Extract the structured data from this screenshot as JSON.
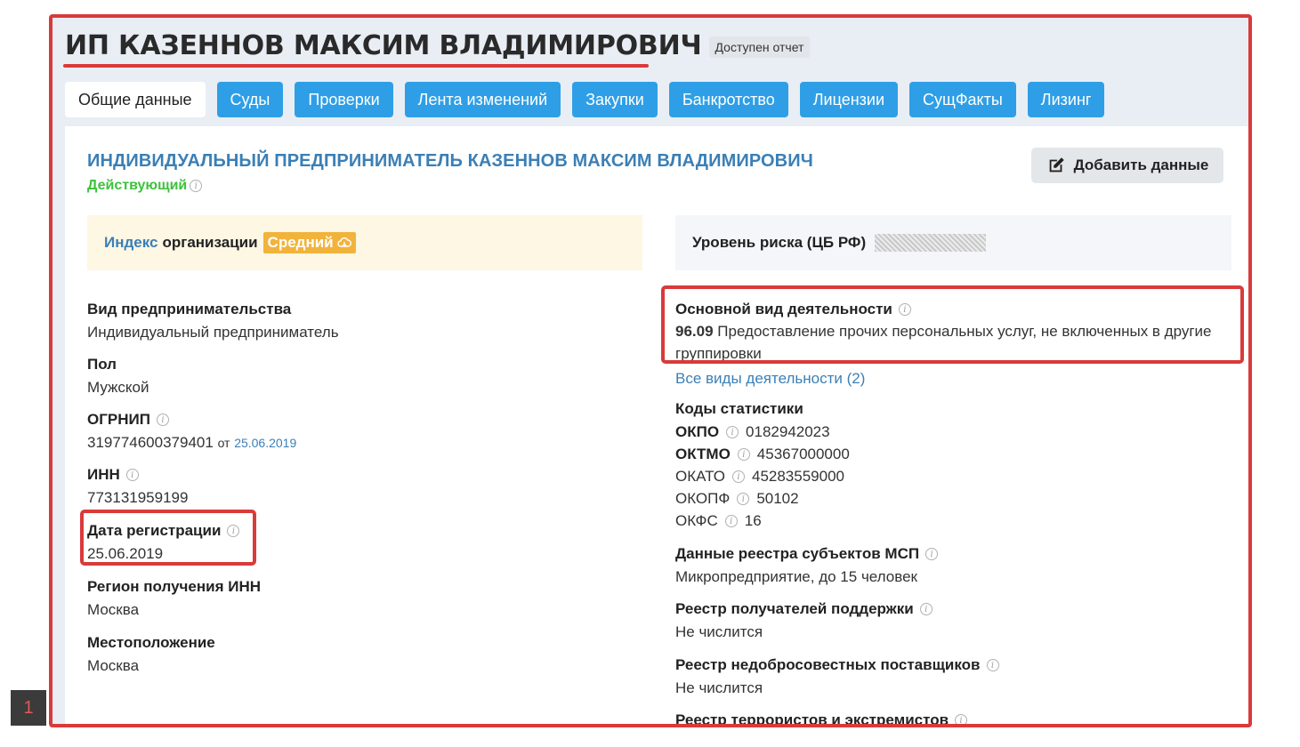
{
  "header": {
    "title": "ИП КАЗЕННОВ МАКСИМ ВЛАДИМИРОВИЧ",
    "badge": "Доступен отчет"
  },
  "tabs": [
    {
      "label": "Общие данные",
      "active": true
    },
    {
      "label": "Суды"
    },
    {
      "label": "Проверки"
    },
    {
      "label": "Лента изменений"
    },
    {
      "label": "Закупки"
    },
    {
      "label": "Банкротство"
    },
    {
      "label": "Лицензии"
    },
    {
      "label": "СущФакты"
    },
    {
      "label": "Лизинг"
    }
  ],
  "org": {
    "full_name": "ИНДИВИДУАЛЬНЫЙ ПРЕДПРИНИМАТЕЛЬ КАЗЕННОВ МАКСИМ ВЛАДИМИРОВИЧ",
    "status": "Действующий",
    "add_button": "Добавить данные"
  },
  "index": {
    "word": "Индекс",
    "label": "организации",
    "level": "Средний"
  },
  "risk": {
    "label": "Уровень риска (ЦБ РФ)"
  },
  "left": {
    "type_label": "Вид предпринимательства",
    "type_value": "Индивидуальный предприниматель",
    "sex_label": "Пол",
    "sex_value": "Мужской",
    "ogrnip_label": "ОГРНИП",
    "ogrnip_value": "319774600379401",
    "ogrnip_from": "от",
    "ogrnip_date": "25.06.2019",
    "inn_label": "ИНН",
    "inn_value": "773131959199",
    "reg_label": "Дата регистрации",
    "reg_value": "25.06.2019",
    "region_label": "Регион получения ИНН",
    "region_value": "Москва",
    "location_label": "Местоположение",
    "location_value": "Москва"
  },
  "right": {
    "okved_label": "Основной вид деятельности",
    "okved_code": "96.09",
    "okved_text": "Предоставление прочих персональных услуг, не включенных в другие группировки",
    "all_activities": "Все виды деятельности (2)",
    "stats_label": "Коды статистики",
    "stats": [
      {
        "key": "ОКПО",
        "value": "0182942023",
        "bold": true
      },
      {
        "key": "ОКТМО",
        "value": "45367000000",
        "bold": true
      },
      {
        "key": "ОКАТО",
        "value": "45283559000",
        "bold": false
      },
      {
        "key": "ОКОПФ",
        "value": "50102",
        "bold": false
      },
      {
        "key": "ОКФС",
        "value": "16",
        "bold": false
      }
    ],
    "msp_label": "Данные реестра субъектов МСП",
    "msp_value": "Микропредприятие, до 15 человек",
    "support_label": "Реестр получателей поддержки",
    "support_value": "Не числится",
    "unfair_label": "Реестр недобросовестных поставщиков",
    "unfair_value": "Не числится",
    "terror_label": "Реестр террористов и экстремистов"
  },
  "page_number": "1",
  "colors": {
    "tab_blue": "#2e9fe6",
    "link_blue": "#3b7fb5",
    "status_green": "#3cc23c",
    "highlight_red": "#d93a3a",
    "index_orange": "#f2b33c"
  }
}
